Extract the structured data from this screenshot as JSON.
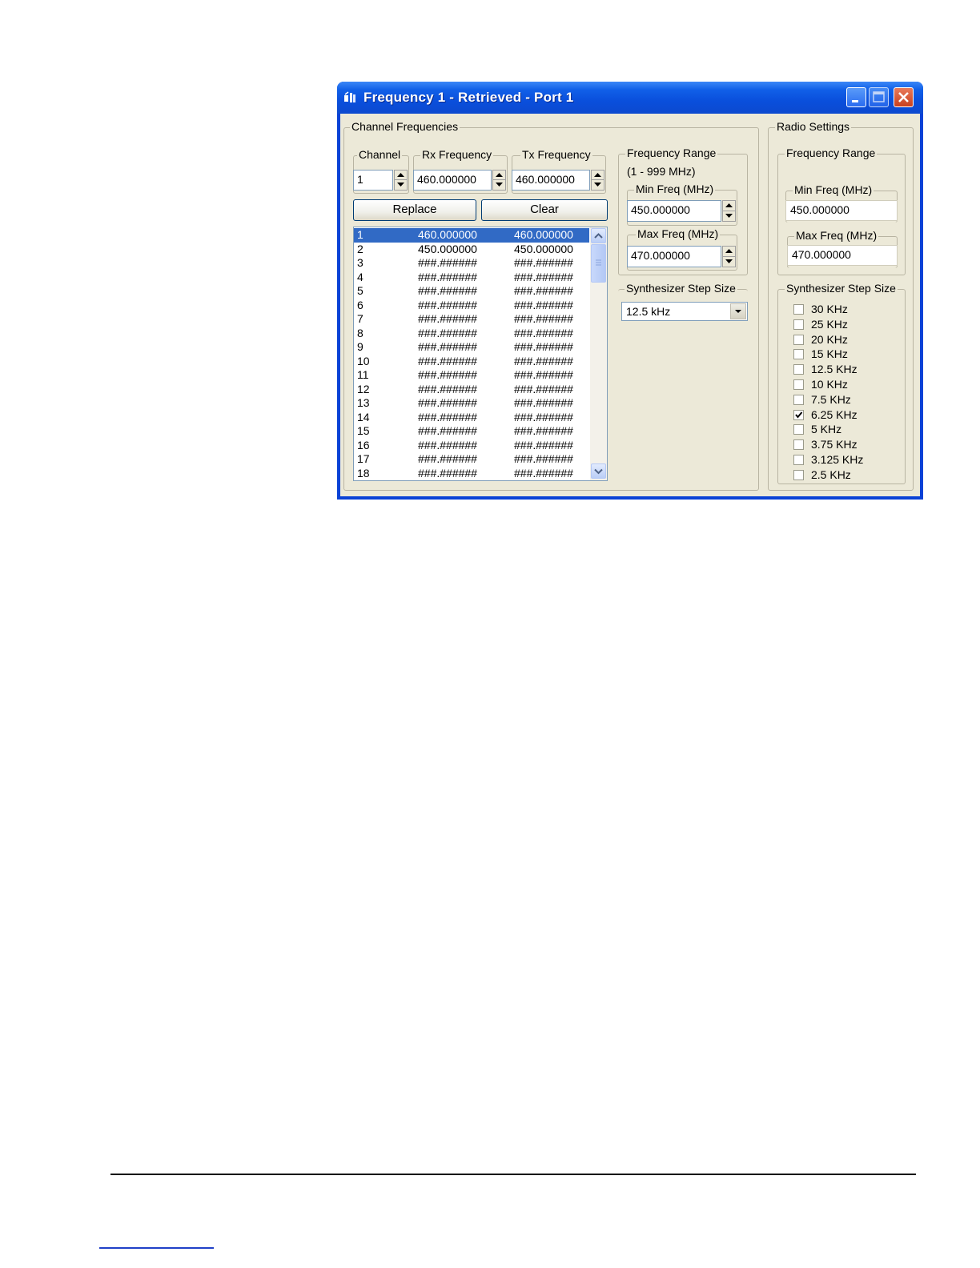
{
  "window": {
    "title": "Frequency 1 - Retrieved - Port 1",
    "title_color": "#0a42d6"
  },
  "channel_frequencies": {
    "group_label": "Channel Frequencies",
    "channel_label": "Channel",
    "rx_label": "Rx Frequency",
    "tx_label": "Tx Frequency",
    "channel_value": "1",
    "rx_value": "460.000000",
    "tx_value": "460.000000",
    "replace_label": "Replace",
    "clear_label": "Clear",
    "rows": [
      [
        "1",
        "460.000000",
        "460.000000"
      ],
      [
        "2",
        "450.000000",
        "450.000000"
      ],
      [
        "3",
        "###.######",
        "###.######"
      ],
      [
        "4",
        "###.######",
        "###.######"
      ],
      [
        "5",
        "###.######",
        "###.######"
      ],
      [
        "6",
        "###.######",
        "###.######"
      ],
      [
        "7",
        "###.######",
        "###.######"
      ],
      [
        "8",
        "###.######",
        "###.######"
      ],
      [
        "9",
        "###.######",
        "###.######"
      ],
      [
        "10",
        "###.######",
        "###.######"
      ],
      [
        "11",
        "###.######",
        "###.######"
      ],
      [
        "12",
        "###.######",
        "###.######"
      ],
      [
        "13",
        "###.######",
        "###.######"
      ],
      [
        "14",
        "###.######",
        "###.######"
      ],
      [
        "15",
        "###.######",
        "###.######"
      ],
      [
        "16",
        "###.######",
        "###.######"
      ],
      [
        "17",
        "###.######",
        "###.######"
      ],
      [
        "18",
        "###.######",
        "###.######"
      ]
    ],
    "selected_row": 0,
    "selection_color": "#316ac5"
  },
  "frequency_range": {
    "group_label": "Frequency Range",
    "range_text": "(1 - 999 MHz)",
    "min_label": "Min Freq (MHz)",
    "min_value": "450.000000",
    "max_label": "Max Freq (MHz)",
    "max_value": "470.000000"
  },
  "synth_step": {
    "group_label": "Synthesizer Step Size",
    "selected": "12.5 kHz"
  },
  "radio_settings": {
    "group_label": "Radio Settings",
    "freq_range_label": "Frequency Range",
    "min_label": "Min Freq (MHz)",
    "min_value": "450.000000",
    "max_label": "Max Freq (MHz)",
    "max_value": "470.000000",
    "step_label": "Synthesizer Step Size",
    "steps": [
      {
        "label": "30 KHz",
        "checked": false
      },
      {
        "label": "25 KHz",
        "checked": false
      },
      {
        "label": "20 KHz",
        "checked": false
      },
      {
        "label": "15 KHz",
        "checked": false
      },
      {
        "label": "12.5 KHz",
        "checked": false
      },
      {
        "label": "10 KHz",
        "checked": false
      },
      {
        "label": "7.5 KHz",
        "checked": false
      },
      {
        "label": "6.25 KHz",
        "checked": true
      },
      {
        "label": "5 KHz",
        "checked": false
      },
      {
        "label": "3.75 KHz",
        "checked": false
      },
      {
        "label": "3.125 KHz",
        "checked": false
      },
      {
        "label": "2.5 KHz",
        "checked": false
      }
    ]
  }
}
